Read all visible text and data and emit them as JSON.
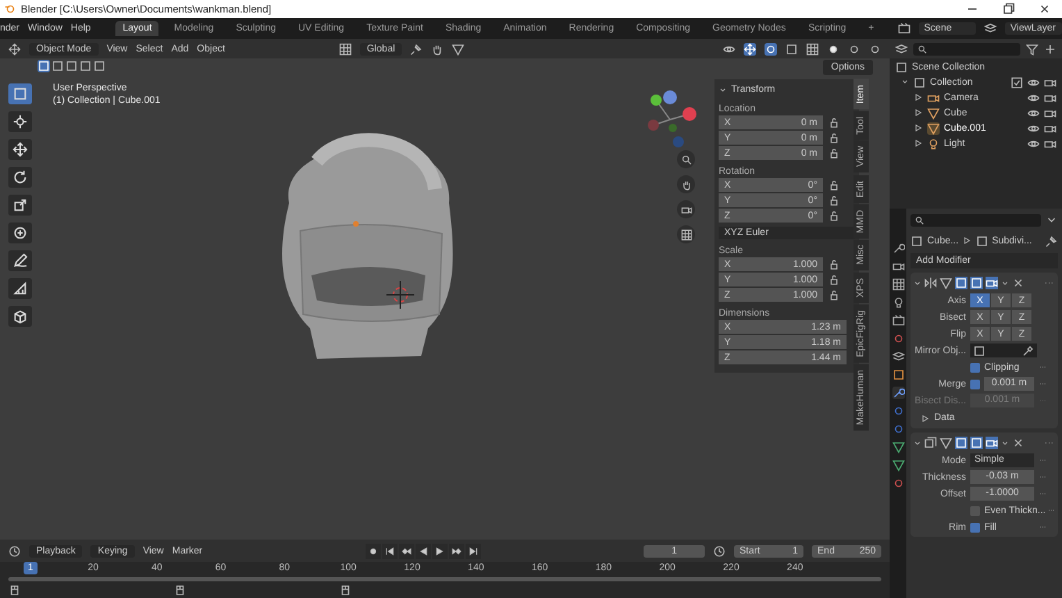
{
  "window": {
    "title": "Blender [C:\\Users\\Owner\\Documents\\wankman.blend]"
  },
  "menu": [
    "nder",
    "Window",
    "Help"
  ],
  "workspaces": [
    {
      "label": "Layout",
      "selected": true
    },
    {
      "label": "Modeling",
      "selected": false
    },
    {
      "label": "Sculpting",
      "selected": false
    },
    {
      "label": "UV Editing",
      "selected": false
    },
    {
      "label": "Texture Paint",
      "selected": false
    },
    {
      "label": "Shading",
      "selected": false
    },
    {
      "label": "Animation",
      "selected": false
    },
    {
      "label": "Rendering",
      "selected": false
    },
    {
      "label": "Compositing",
      "selected": false
    },
    {
      "label": "Geometry Nodes",
      "selected": false
    },
    {
      "label": "Scripting",
      "selected": false
    }
  ],
  "add_workspace": "+",
  "scene": "Scene",
  "view_layer": "ViewLayer",
  "viewport": {
    "mode": "Object Mode",
    "menu": [
      "View",
      "Select",
      "Add",
      "Object"
    ],
    "orientation": "Global",
    "options": "Options",
    "overlay_text": [
      "User Perspective",
      "(1) Collection | Cube.001"
    ]
  },
  "n_panel": {
    "title": "Transform",
    "tabs": [
      {
        "label": "Item",
        "selected": true
      },
      {
        "label": "Tool",
        "selected": false
      },
      {
        "label": "View",
        "selected": false
      },
      {
        "label": "Edit",
        "selected": false
      },
      {
        "label": "MMD",
        "selected": false
      },
      {
        "label": "Misc",
        "selected": false
      },
      {
        "label": "XPS",
        "selected": false
      },
      {
        "label": "EpicFigRig",
        "selected": false
      },
      {
        "label": "MakeHuman",
        "selected": false
      }
    ],
    "sections": [
      {
        "label": "Location",
        "lockable": true,
        "fields": [
          {
            "axis": "X",
            "value": "0 m"
          },
          {
            "axis": "Y",
            "value": "0 m"
          },
          {
            "axis": "Z",
            "value": "0 m"
          }
        ]
      },
      {
        "label": "Rotation",
        "lockable": true,
        "fields": [
          {
            "axis": "X",
            "value": "0°"
          },
          {
            "axis": "Y",
            "value": "0°"
          },
          {
            "axis": "Z",
            "value": "0°"
          }
        ],
        "mode": "XYZ Euler"
      },
      {
        "label": "Scale",
        "lockable": true,
        "fields": [
          {
            "axis": "X",
            "value": "1.000"
          },
          {
            "axis": "Y",
            "value": "1.000"
          },
          {
            "axis": "Z",
            "value": "1.000"
          }
        ]
      },
      {
        "label": "Dimensions",
        "lockable": false,
        "fields": [
          {
            "axis": "X",
            "value": "1.23 m"
          },
          {
            "axis": "Y",
            "value": "1.18 m"
          },
          {
            "axis": "Z",
            "value": "1.44 m"
          }
        ]
      }
    ]
  },
  "outliner": {
    "root": "Scene Collection",
    "collection": {
      "name": "Collection",
      "expanded": true,
      "children": [
        {
          "name": "Camera",
          "kind": "camera",
          "selected": false
        },
        {
          "name": "Cube",
          "kind": "mesh",
          "selected": false
        },
        {
          "name": "Cube.001",
          "kind": "mesh",
          "selected": true
        },
        {
          "name": "Light",
          "kind": "light",
          "selected": false
        }
      ]
    }
  },
  "properties": {
    "breadcrumb": [
      "Cube...",
      "Subdivi..."
    ],
    "add_modifier": "Add Modifier",
    "modifiers": [
      {
        "kind": "mirror",
        "rows": [
          {
            "kind": "toggles",
            "label": "Axis",
            "options": [
              {
                "label": "X",
                "selected": true
              },
              {
                "label": "Y",
                "selected": false
              },
              {
                "label": "Z",
                "selected": false
              }
            ]
          },
          {
            "kind": "toggles",
            "label": "Bisect",
            "options": [
              {
                "label": "X",
                "selected": false
              },
              {
                "label": "Y",
                "selected": false
              },
              {
                "label": "Z",
                "selected": false
              }
            ]
          },
          {
            "kind": "toggles",
            "label": "Flip",
            "options": [
              {
                "label": "X",
                "selected": false
              },
              {
                "label": "Y",
                "selected": false
              },
              {
                "label": "Z",
                "selected": false
              }
            ]
          },
          {
            "kind": "object",
            "label": "Mirror Obj..."
          },
          {
            "kind": "checkbox",
            "label": "Clipping",
            "checked": true
          },
          {
            "kind": "check_number",
            "label": "Merge",
            "checked": true,
            "value": "0.001 m"
          },
          {
            "kind": "number",
            "label": "Bisect Dis...",
            "value": "0.001 m",
            "disabled": true
          },
          {
            "kind": "subpanel",
            "label": "Data"
          }
        ]
      },
      {
        "kind": "solidify",
        "rows": [
          {
            "kind": "dropdown",
            "label": "Mode",
            "value": "Simple"
          },
          {
            "kind": "number",
            "label": "Thickness",
            "value": "-0.03 m",
            "disabled": false
          },
          {
            "kind": "number",
            "label": "Offset",
            "value": "-1.0000",
            "disabled": false
          },
          {
            "kind": "checkbox",
            "label": "Even Thickn...",
            "checked": false
          },
          {
            "kind": "labeled_checkbox",
            "label": "Rim",
            "text": "Fill",
            "checked": true
          }
        ]
      }
    ]
  },
  "timeline": {
    "menu": [
      "Playback",
      "Keying",
      "View",
      "Marker"
    ],
    "current": "1",
    "start_label": "Start",
    "start": "1",
    "end_label": "End",
    "end": "250",
    "playhead": "1",
    "ticks": [
      "20",
      "40",
      "60",
      "80",
      "100",
      "120",
      "140",
      "160",
      "180",
      "200",
      "220",
      "240"
    ]
  }
}
